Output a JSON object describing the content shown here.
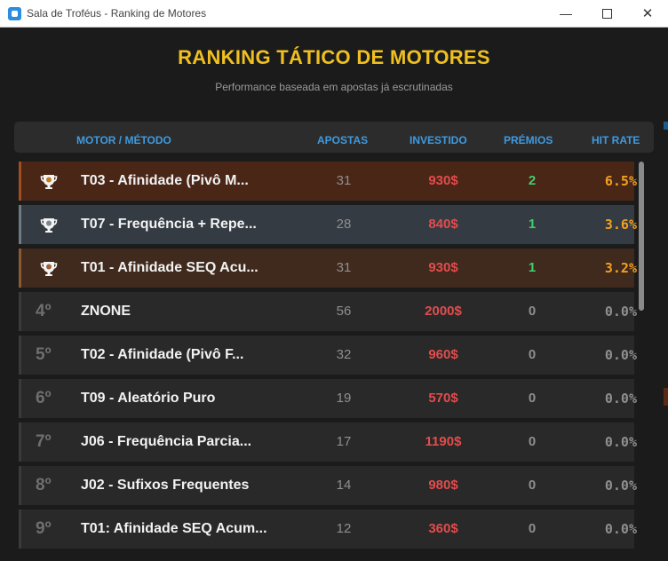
{
  "window": {
    "title": "Sala de Troféus - Ranking de Motores",
    "controls": {
      "minimize": "—",
      "close": "✕"
    }
  },
  "header": {
    "title": "RANKING TÁTICO DE MOTORES",
    "subtitle": "Performance baseada em apostas já escrutinadas"
  },
  "table": {
    "columns": {
      "motor": "MOTOR / MÉTODO",
      "apostas": "APOSTAS",
      "investido": "INVESTIDO",
      "premios": "PRÉMIOS",
      "hit_rate": "HIT RATE"
    },
    "rows": [
      {
        "rank": "",
        "medal": "trophy-gold-icon",
        "name": "T03 - Afinidade (Pivô M...",
        "apostas": "31",
        "investido": "930$",
        "premios": "2",
        "hit_rate": "6.5%"
      },
      {
        "rank": "",
        "medal": "trophy-silver-icon",
        "name": "T07 - Frequência + Repe...",
        "apostas": "28",
        "investido": "840$",
        "premios": "1",
        "hit_rate": "3.6%"
      },
      {
        "rank": "",
        "medal": "trophy-bronze-icon",
        "name": "T01 - Afinidade SEQ Acu...",
        "apostas": "31",
        "investido": "930$",
        "premios": "1",
        "hit_rate": "3.2%"
      },
      {
        "rank": "4º",
        "medal": "",
        "name": "ZNONE",
        "apostas": "56",
        "investido": "2000$",
        "premios": "0",
        "hit_rate": "0.0%"
      },
      {
        "rank": "5º",
        "medal": "",
        "name": "T02 - Afinidade (Pivô F...",
        "apostas": "32",
        "investido": "960$",
        "premios": "0",
        "hit_rate": "0.0%"
      },
      {
        "rank": "6º",
        "medal": "",
        "name": "T09 - Aleatório Puro",
        "apostas": "19",
        "investido": "570$",
        "premios": "0",
        "hit_rate": "0.0%"
      },
      {
        "rank": "7º",
        "medal": "",
        "name": "J06 - Frequência Parcia...",
        "apostas": "17",
        "investido": "1190$",
        "premios": "0",
        "hit_rate": "0.0%"
      },
      {
        "rank": "8º",
        "medal": "",
        "name": "J02 - Sufixos Frequentes",
        "apostas": "14",
        "investido": "980$",
        "premios": "0",
        "hit_rate": "0.0%"
      },
      {
        "rank": "9º",
        "medal": "",
        "name": "T01: Afinidade SEQ Acum...",
        "apostas": "12",
        "investido": "360$",
        "premios": "0",
        "hit_rate": "0.0%"
      }
    ]
  },
  "colors": {
    "title": "#f0c020",
    "header_text": "#3f9ae0",
    "investido": "#e34c4c",
    "premio_positive": "#3ecf6b",
    "premio_zero": "#8f8f8f",
    "hit_positive": "#f0a020",
    "hit_zero": "#8f8f8f"
  }
}
